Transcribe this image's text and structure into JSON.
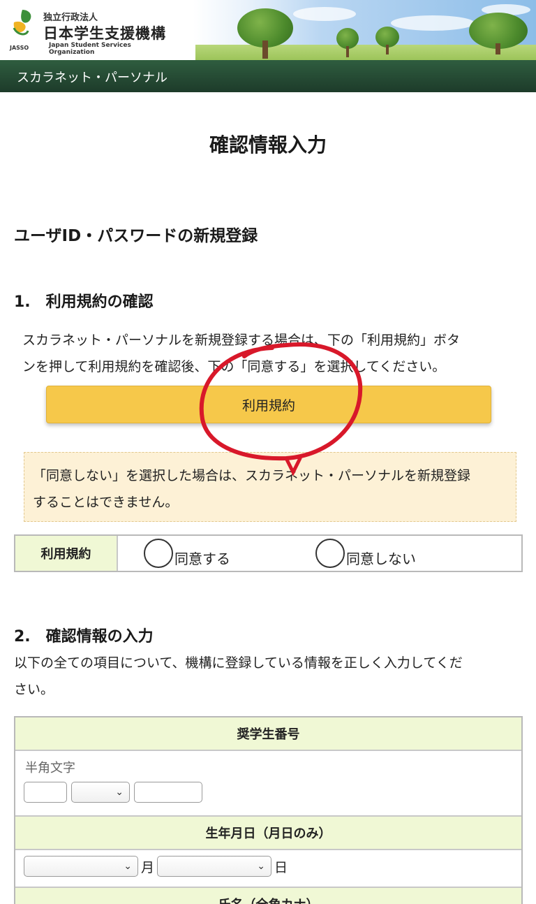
{
  "header": {
    "org_type": "独立行政法人",
    "org_name": "日本学生支援機構",
    "org_name_en": "Japan Student Services Organization",
    "org_abbr": "JASSO",
    "service_name": "スカラネット・パーソナル"
  },
  "page": {
    "title": "確認情報入力",
    "section_title": "ユーザID・パスワードの新規登録"
  },
  "step1": {
    "title": "1.　利用規約の確認",
    "instruction_line1": "スカラネット・パーソナルを新規登録する場合は、下の「利用規約」ボタ",
    "instruction_line2": "ンを押して利用規約を確認後、下の「同意する」を選択してください。",
    "terms_button_label": "利用規約",
    "notice_line1": "「同意しない」を選択した場合は、スカラネット・パーソナルを新規登録",
    "notice_line2": "することはできません。",
    "agreement_label": "利用規約",
    "agree_option": "同意する",
    "disagree_option": "同意しない"
  },
  "step2": {
    "title": "2.　確認情報の入力",
    "instruction_line1": "以下の全ての項目について、機構に登録している情報を正しく入力してくだ",
    "instruction_line2": "さい。",
    "fields": {
      "scholarship_number": {
        "label": "奨学生番号",
        "hint": "半角文字"
      },
      "birthdate": {
        "label": "生年月日（月日のみ）",
        "month_unit": "月",
        "day_unit": "日"
      },
      "name": {
        "label": "氏名（全角カナ）"
      }
    }
  },
  "colors": {
    "button": "#f6c84a",
    "header_bar": "#1d3b2a",
    "table_header": "#f0f8d5",
    "notice_bg": "#fdf1d6",
    "annotation": "#d8182a"
  }
}
